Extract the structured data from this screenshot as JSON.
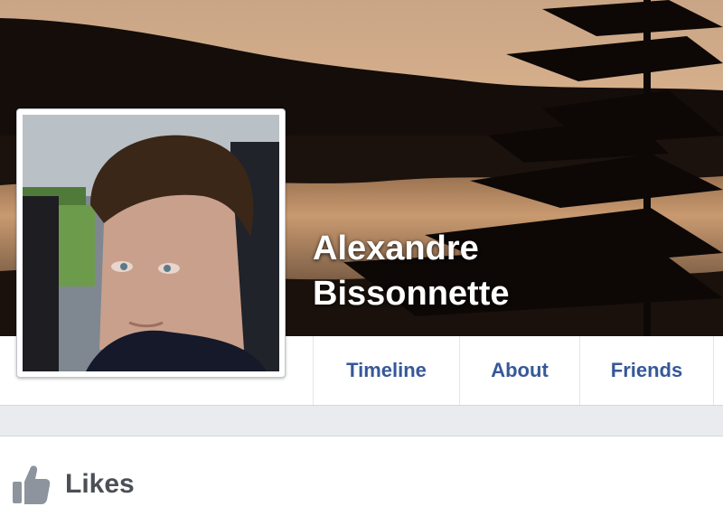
{
  "profile": {
    "first_name": "Alexandre",
    "last_name": "Bissonnette"
  },
  "nav": {
    "tabs": [
      {
        "label": "Timeline"
      },
      {
        "label": "About"
      },
      {
        "label": "Friends"
      }
    ]
  },
  "likes": {
    "title": "Likes",
    "icon": "thumbs-up-icon"
  },
  "colors": {
    "link_blue": "#365899",
    "page_bg": "#e9ebee",
    "heading_gray": "#4b4f56"
  }
}
